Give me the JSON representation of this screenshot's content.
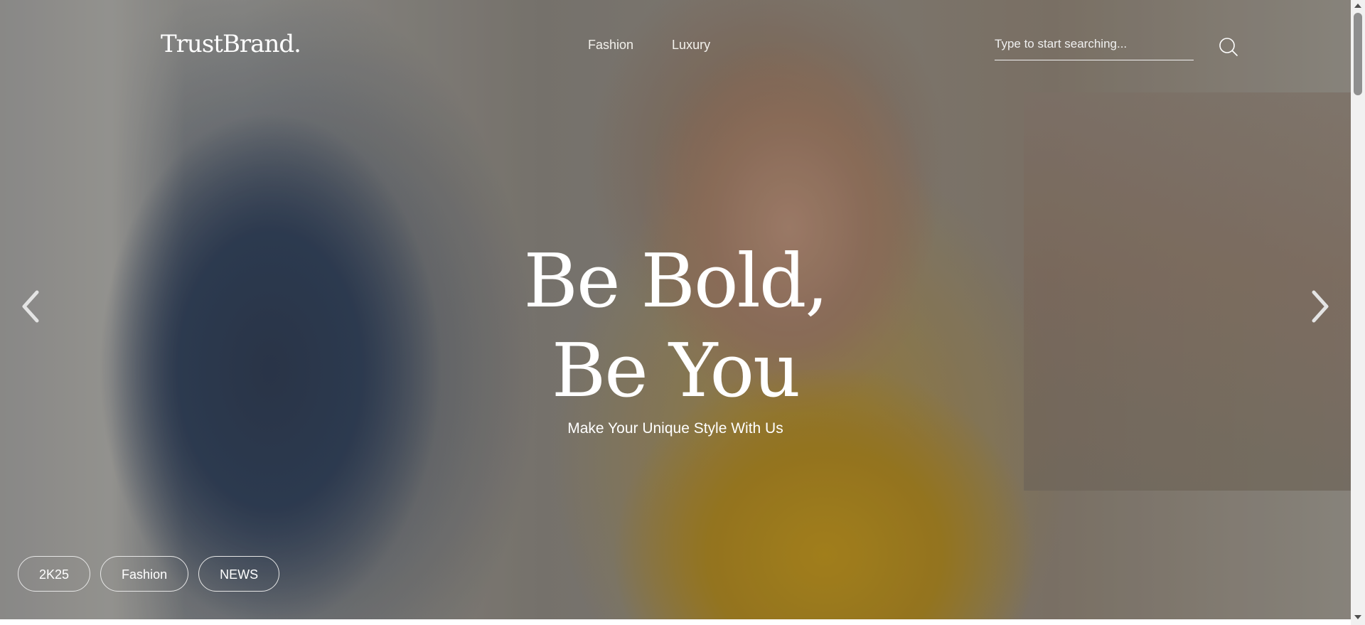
{
  "brand": {
    "logo_text": "TrustBrand."
  },
  "nav": {
    "items": [
      "Fashion",
      "Luxury"
    ]
  },
  "search": {
    "placeholder": "Type to start searching..."
  },
  "hero": {
    "headline_line1": "Be Bold,",
    "headline_line2": "Be You",
    "subline": "Make Your Unique Style With Us"
  },
  "tags": [
    "2K25",
    "Fashion",
    "NEWS"
  ],
  "icons": {
    "search": "search-icon",
    "prev": "chevron-left-icon",
    "next": "chevron-right-icon"
  },
  "colors": {
    "text": "#ffffff"
  }
}
